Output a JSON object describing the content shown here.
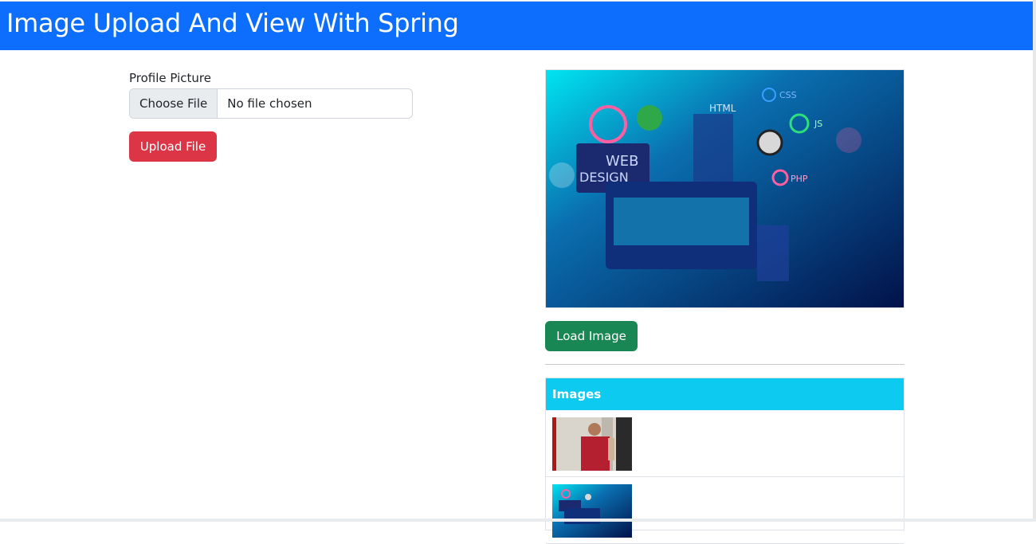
{
  "header": {
    "title": "Image Upload And View With Spring"
  },
  "form": {
    "label": "Profile Picture",
    "choose_file": "Choose File",
    "file_status": "No file chosen",
    "upload_button": "Upload File"
  },
  "preview": {
    "image_labels": {
      "web": "WEB",
      "design": "DESIGN",
      "html": "HTML",
      "css": "CSS",
      "js": "JS",
      "php": "PHP"
    },
    "load_button": "Load Image"
  },
  "images_card": {
    "title": "Images",
    "items": [
      {
        "description": "student-photo"
      },
      {
        "description": "web-design-illustration"
      }
    ]
  },
  "colors": {
    "primary": "#0d6efd",
    "danger": "#dc3545",
    "success": "#198754",
    "info": "#0dcaf0"
  }
}
